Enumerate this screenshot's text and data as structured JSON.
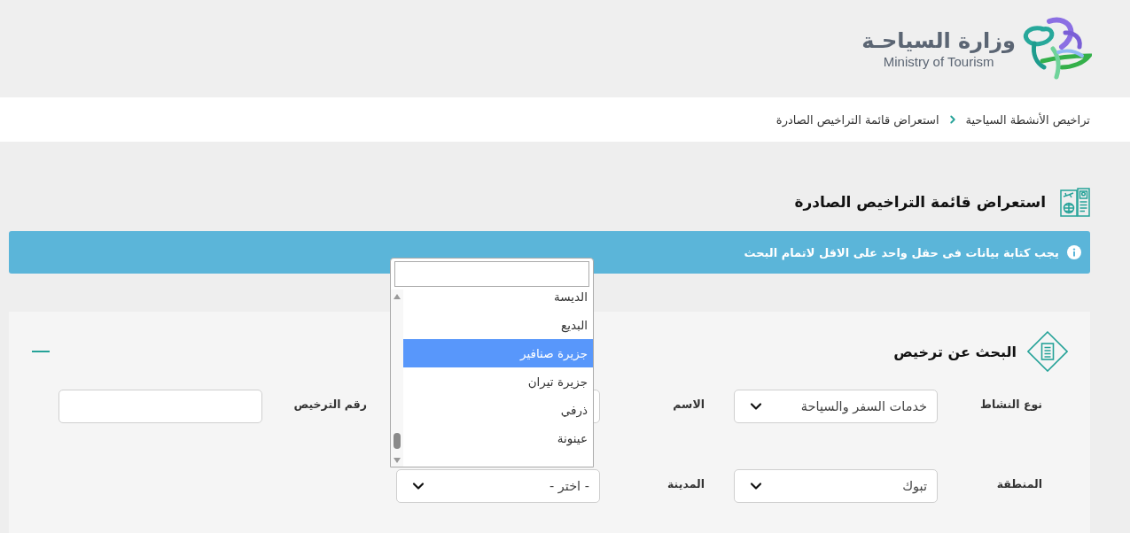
{
  "header": {
    "ministry_name_arabic": "وزارة السياحـة",
    "ministry_name_english": "Ministry of Tourism"
  },
  "breadcrumb": [
    {
      "label": "تراخيص الأنشطة السياحية"
    },
    {
      "label": "استعراض قائمة التراخيص الصادرة"
    }
  ],
  "page_title": "استعراض قائمة التراخيص الصادرة",
  "alert": {
    "text": "يجب كتابة بيانات فى حقل واحد على الاقل لاتمام البحث"
  },
  "search_panel": {
    "title": "البحث عن ترخيص",
    "expanded": true,
    "fields": [
      {
        "label": "نوع النشاط",
        "kind": "select",
        "value": "خدمات السفر والسياحة"
      },
      {
        "label": "الاسم",
        "kind": "input"
      },
      {
        "label": "رقم الترخيص",
        "kind": "input"
      },
      {
        "label": "المنطقة",
        "kind": "select",
        "value": "تبوك"
      },
      {
        "label": "المدينة",
        "kind": "select",
        "value": "- اختر -",
        "open": true,
        "options": [
          {
            "label": "الديسة",
            "selected": false
          },
          {
            "label": "البديع",
            "selected": false
          },
          {
            "label": "جزيرة صنافير",
            "selected": true
          },
          {
            "label": "جزيرة تيران",
            "selected": false
          },
          {
            "label": "ذرفي",
            "selected": false
          },
          {
            "label": "عينونة",
            "selected": false
          }
        ]
      }
    ]
  }
}
